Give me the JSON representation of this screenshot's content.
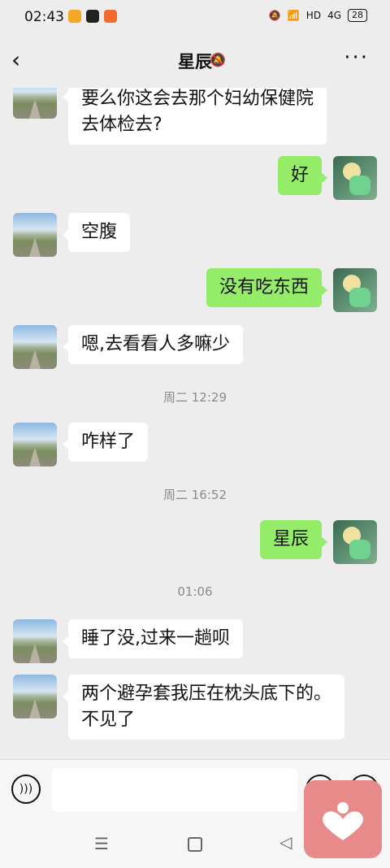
{
  "status": {
    "time": "02:43",
    "battery": "28",
    "network": "4G",
    "hd": "HD"
  },
  "header": {
    "title": "星辰"
  },
  "messages": [
    {
      "side": "in",
      "text": "要么你这会去那个妇幼保健院\n去体检去?"
    },
    {
      "side": "out",
      "text": "好"
    },
    {
      "side": "in",
      "text": "空腹"
    },
    {
      "side": "out",
      "text": "没有吃东西"
    },
    {
      "side": "in",
      "text": "嗯,去看看人多嘛少"
    },
    {
      "type": "time",
      "text": "周二 12:29"
    },
    {
      "side": "in",
      "text": "咋样了"
    },
    {
      "type": "time",
      "text": "周二 16:52"
    },
    {
      "side": "out",
      "text": "星辰"
    },
    {
      "type": "time",
      "text": "01:06"
    },
    {
      "side": "in",
      "text": "睡了没,过来一趟呗"
    },
    {
      "side": "in",
      "text": "两个避孕套我压在枕头底下的。\n不见了"
    }
  ],
  "input": {
    "placeholder": ""
  },
  "icons": {
    "back": "chevron-left-icon",
    "mute": "bell-off-icon",
    "more": "more-icon",
    "voice": "voice-icon",
    "emoji": "emoji-icon",
    "plus": "plus-icon"
  },
  "colors": {
    "bg": "#ededed",
    "incoming": "#ffffff",
    "outgoing": "#95ec69"
  }
}
